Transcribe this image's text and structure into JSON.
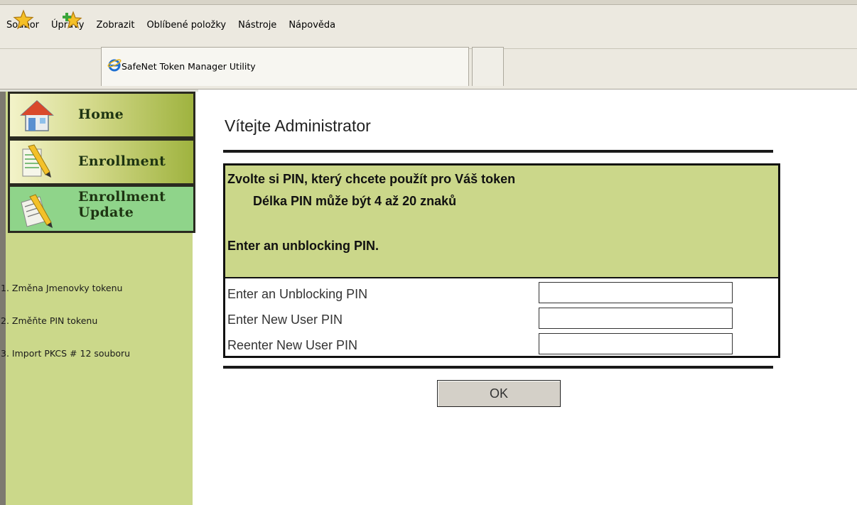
{
  "browser": {
    "menu": [
      "Soubor",
      "Úpravy",
      "Zobrazit",
      "Oblíbené položky",
      "Nástroje",
      "Nápověda"
    ],
    "tab_title": "SafeNet Token Manager Utility"
  },
  "sidebar": {
    "nav": [
      {
        "label": "Home"
      },
      {
        "label": "Enrollment"
      },
      {
        "label_line1": "Enrollment",
        "label_line2": "Update"
      }
    ],
    "links": [
      "1. Změna Jmenovky tokenu",
      "2. Změňte PIN tokenu",
      "3. Import PKCS # 12 souboru"
    ]
  },
  "main": {
    "title": "Vítejte Administrator",
    "panel": {
      "line1": "Zvolte si PIN, který chcete použít pro Váš token",
      "line2": "Délka PIN může být 4 až 20 znaků",
      "line3": "Enter an unblocking PIN."
    },
    "fields": [
      {
        "label": "Enter an Unblocking PIN",
        "value": ""
      },
      {
        "label": "Enter New User PIN",
        "value": ""
      },
      {
        "label": "Reenter New User PIN",
        "value": ""
      }
    ],
    "ok_label": "OK"
  },
  "colors": {
    "sidebar_bg": "#cbd88a",
    "panel_bg": "#cbd78a",
    "active_nav": "#8fd48a"
  },
  "icons": {
    "favorites": "favorites-star-icon",
    "add_favorites": "add-favorites-icon",
    "tab": "internet-explorer-icon",
    "home": "home-icon",
    "enrollment": "pencil-notepad-icon",
    "enrollment_update": "pencil-notepad-update-icon"
  }
}
